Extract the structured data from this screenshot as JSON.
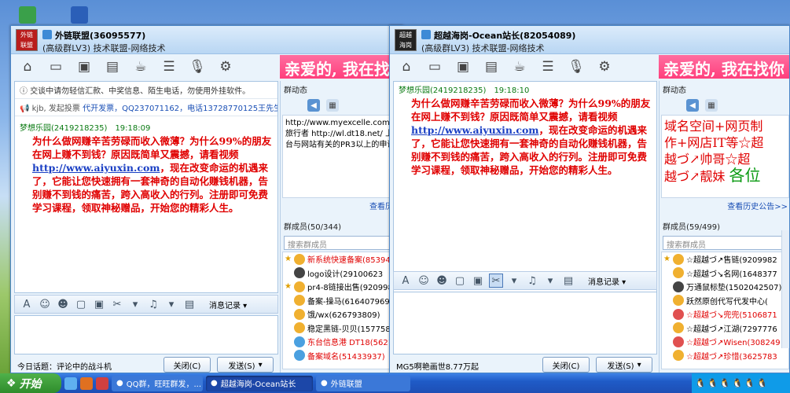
{
  "desktop": {
    "icons": [
      "recycle-icon",
      "word-doc-icon"
    ]
  },
  "win1": {
    "avatar_text": "外链\n联盟",
    "title": "外链联盟(36095577)",
    "subtitle": "(高级群LV3) 技术联盟-网络技术",
    "banner": "亲爱的, 我在找",
    "notice": "交谈中请勿轻信汇款、中奖信息、陌生电话，勿使用外挂软件。",
    "notice2_gray": "kjb, 发起投票",
    "notice2_blue": "代开发票，QQ237071162，电话13728770125王先生",
    "msg_sender": "梦想乐园(2419218235)",
    "msg_time": "19:18:09",
    "msg_part1": "为什么做网赚辛苦劳碌而收入微薄？为什么99%的朋友在网上赚不到钱？原因既简单又震撼，请看视频",
    "msg_link": "http://www.aiyuxin.com",
    "msg_part2": "，现在改变命运的机遇来了，它能让您快速拥有一套神奇的自动化赚钱机器，告别赚不到钱的痛苦，跨入高收入的行列。注册即可免费学习课程，领取神秘赠品，开始您的精彩人生。",
    "history_label": "消息记录",
    "status": "今日话题：评论中的战斗机",
    "close_label": "关闭(C)",
    "send_label": "发送(S)",
    "bulletin_title": "群动态",
    "bulletin_lines": [
      "http://www.myexcelle.com/",
      "旅行者 http://wl.dt18.net/ 上",
      "台与网站有关的PR3以上的申请"
    ],
    "history_link": "查看历史",
    "members_title": "群成员(50/344)",
    "search_placeholder": "搜索群成员",
    "members": [
      {
        "name": "新系统快速备案(85394",
        "red": true,
        "star": true
      },
      {
        "name": "logo设计(29100623",
        "red": false,
        "star": false
      },
      {
        "name": "pr4-8链接出售(920998",
        "red": false,
        "star": true
      },
      {
        "name": "备案-操马(616407969)",
        "red": false,
        "star": false
      },
      {
        "name": "饿/wx(626793809)",
        "red": false,
        "star": false
      },
      {
        "name": "稳定黑链-贝贝(1577585",
        "red": false,
        "star": false
      },
      {
        "name": "东台信息港 DT18(56218",
        "red": true,
        "star": false
      },
      {
        "name": "备案域名(51433937)",
        "red": true,
        "star": false
      }
    ]
  },
  "win2": {
    "avatar_text": "超越\n海岗",
    "title": "超越海岗-Ocean站长(82054089)",
    "subtitle": "(高级群LV3) 技术联盟-网络技术",
    "banner": "亲爱的, 我在找你",
    "msg_sender": "梦想乐园(2419218235)",
    "msg_time": "19:18:10",
    "msg_part1": "为什么做网赚辛苦劳碌而收入微薄？为什么99%的朋友在网上赚不到钱？原因既简单又震撼，请看视频",
    "msg_link": "http://www.aiyuxin.com",
    "msg_part2": "，现在改变命运的机遇来了，它能让您快速拥有一套神奇的自动化赚钱机器，告别赚不到钱的痛苦，跨入高收入的行列。注册即可免费学习课程，领取神秘赠品，开始您的精彩人生。",
    "history_label": "消息记录",
    "status": "MG5啊艳画世8.77万起",
    "close_label": "关闭(C)",
    "send_label": "发送(S)",
    "bulletin_title": "群动态",
    "bulletin_line1": "域名空间+网页制",
    "bulletin_line2": "作+网店IT等☆超",
    "bulletin_line3": "越づ↗帅哥☆超",
    "bulletin_line4": "越づ↗靓妹",
    "bulletin_green": "各位",
    "history_link": "查看历史公告>>",
    "members_title": "群成员(59/499)",
    "search_placeholder": "搜索群成员",
    "members": [
      {
        "name": "☆超越づ↗售链(9209982",
        "red": false,
        "star": true
      },
      {
        "name": "☆超越づ↘名网(1648377",
        "red": false,
        "star": false
      },
      {
        "name": "万通鼠标垫(1502042507)",
        "red": false,
        "star": false
      },
      {
        "name": "跃然原创代写代发中心(",
        "red": false,
        "star": false
      },
      {
        "name": "☆超越づ↘兜兜(5106871",
        "red": true,
        "star": false
      },
      {
        "name": "☆超越づ↗江湖(7297776",
        "red": false,
        "star": false
      },
      {
        "name": "☆超越づ↗Wisen(308249",
        "red": true,
        "star": false
      },
      {
        "name": "☆超越づ↗珍惜(3625783",
        "red": true,
        "star": false
      }
    ]
  },
  "taskbar": {
    "start_label": "开始",
    "tasks": [
      "QQ群，旺旺群发，...",
      "超越海岗-Ocean站长",
      "外链联盟"
    ]
  }
}
